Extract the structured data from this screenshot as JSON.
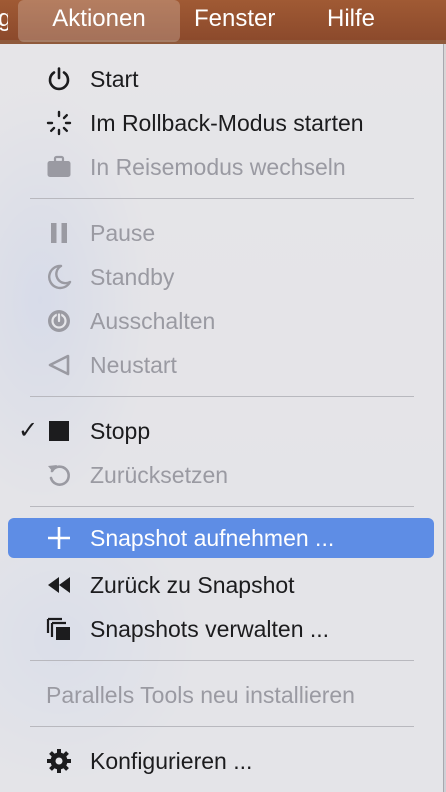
{
  "menubar": {
    "partial_item": "g",
    "items": [
      "Aktionen",
      "Fenster",
      "Hilfe"
    ]
  },
  "menu": {
    "groups": [
      [
        {
          "label": "Start",
          "icon": "power-icon",
          "enabled": true
        },
        {
          "label": "Im Rollback-Modus starten",
          "icon": "spinner-icon",
          "enabled": true
        },
        {
          "label": "In Reisemodus wechseln",
          "icon": "briefcase-icon",
          "enabled": false
        }
      ],
      [
        {
          "label": "Pause",
          "icon": "pause-icon",
          "enabled": false
        },
        {
          "label": "Standby",
          "icon": "moon-icon",
          "enabled": false
        },
        {
          "label": "Ausschalten",
          "icon": "shutdown-icon",
          "enabled": false
        },
        {
          "label": "Neustart",
          "icon": "triangle-left-icon",
          "enabled": false
        }
      ],
      [
        {
          "label": "Stopp",
          "icon": "stop-icon",
          "enabled": true,
          "checked": true,
          "checkmark": "✓"
        },
        {
          "label": "Zurücksetzen",
          "icon": "reset-icon",
          "enabled": false
        }
      ],
      [
        {
          "label": "Snapshot aufnehmen ...",
          "icon": "plus-icon",
          "enabled": true,
          "highlighted": true
        },
        {
          "label": "Zurück zu Snapshot",
          "icon": "rewind-icon",
          "enabled": true
        },
        {
          "label": "Snapshots verwalten ...",
          "icon": "snapshots-icon",
          "enabled": true
        }
      ],
      [
        {
          "label": "Parallels Tools neu installieren",
          "enabled": false
        }
      ],
      [
        {
          "label": "Konfigurieren ...",
          "icon": "gear-icon",
          "enabled": true
        }
      ]
    ]
  },
  "colors": {
    "menubar_bg": "#95502f",
    "highlight": "#5e8de5",
    "text": "#1c1c1e",
    "disabled_text": "#9a9aa2"
  }
}
